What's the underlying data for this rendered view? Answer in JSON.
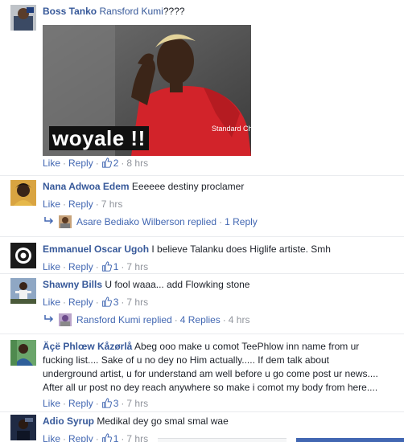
{
  "comments": [
    {
      "name": "Boss Tanko",
      "mention": "Ransford Kumi",
      "text": "????",
      "photo_caption": "woyale !!",
      "jersey_text": "Standard Chartered",
      "like": "Like",
      "reply": "Reply",
      "likes": "2",
      "time": "8 hrs"
    },
    {
      "name": "Nana Adwoa Edem",
      "text": "Eeeeee destiny proclamer",
      "like": "Like",
      "reply": "Reply",
      "time": "7 hrs",
      "replies": {
        "name": "Asare Bediako Wilberson",
        "replied": "replied",
        "count": "1 Reply"
      }
    },
    {
      "name": "Emmanuel Oscar Ugoh",
      "text": "I believe Talanku does Higlife artiste. Smh",
      "like": "Like",
      "reply": "Reply",
      "likes": "1",
      "time": "7 hrs"
    },
    {
      "name": "Shawny Bills",
      "text": "U fool waaa... add Flowking stone",
      "like": "Like",
      "reply": "Reply",
      "likes": "3",
      "time": "7 hrs",
      "replies": {
        "name": "Ransford Kumi",
        "replied": "replied",
        "count": "4 Replies",
        "time": "4 hrs"
      }
    },
    {
      "name": "Äçë Phlœw Kåzørlå",
      "text_line1": "Abeg ooo make u comot TeePhlow inn name from ur",
      "text_line2": "fucking list.... Sake of u no dey no Him actually..... If dem talk about",
      "text_line3": "underground artist, u for understand am well before u go come post ur news....",
      "text_line4": "After all ur post no dey reach anywhere so make i comot my body from here....",
      "like": "Like",
      "reply": "Reply",
      "likes": "3",
      "time": "7 hrs"
    },
    {
      "name": "Adio Syrup",
      "text": "Medikal dey go smal smal wae",
      "like": "Like",
      "reply": "Reply",
      "likes": "1",
      "time": "7 hrs"
    }
  ],
  "colors": {
    "name": "#365899",
    "link": "#4267b2",
    "meta": "#90949c",
    "text": "#1d2129"
  },
  "icons": {
    "like": "thumbs-up-icon",
    "reply_arrow": "reply-arrow-icon"
  }
}
